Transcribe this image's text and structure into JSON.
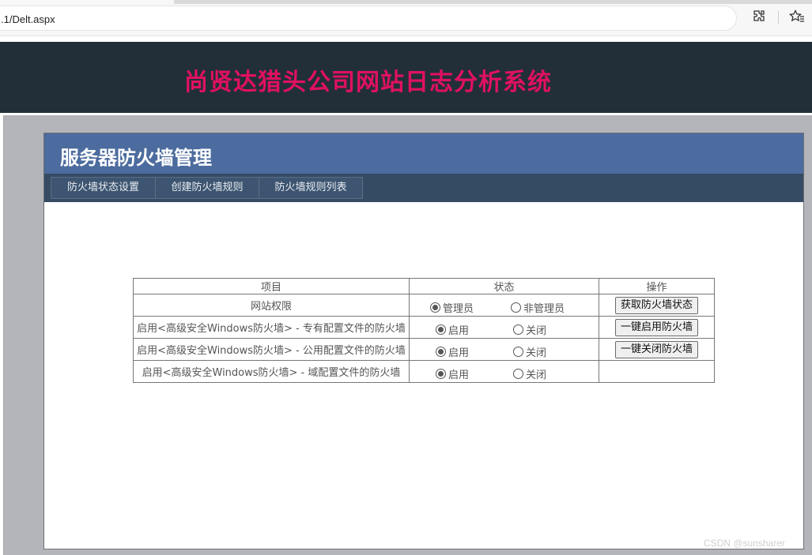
{
  "browser": {
    "url": ".1/Delt.aspx",
    "icons": [
      "extension-icon",
      "favorites-icon"
    ]
  },
  "site": {
    "title": "尚贤达猎头公司网站日志分析系统",
    "title_color": "#e0115f",
    "header_bg": "#222f39"
  },
  "panel": {
    "title": "服务器防火墙管理",
    "title_bg": "#4c6c9f",
    "nav_bg": "#354b63",
    "tabs": [
      {
        "label": "防火墙状态设置"
      },
      {
        "label": "创建防火墙规则"
      },
      {
        "label": "防火墙规则列表"
      }
    ]
  },
  "table": {
    "headers": {
      "item": "项目",
      "state": "状态",
      "op": "操作"
    },
    "rows": [
      {
        "item": "网站权限",
        "option_a": "管理员",
        "option_b": "非管理员",
        "selected": "option_a",
        "action": "获取防火墙状态"
      },
      {
        "item": "启用<高级安全Windows防火墙> - 专有配置文件的防火墙",
        "option_a": "启用",
        "option_b": "关闭",
        "selected": "option_a",
        "action": "一键启用防火墙"
      },
      {
        "item": "启用<高级安全Windows防火墙> - 公用配置文件的防火墙",
        "option_a": "启用",
        "option_b": "关闭",
        "selected": "option_a",
        "action": "一键关闭防火墙"
      },
      {
        "item": "启用<高级安全Windows防火墙> - 域配置文件的防火墙",
        "option_a": "启用",
        "option_b": "关闭",
        "selected": "option_a",
        "action": ""
      }
    ]
  },
  "watermark": "CSDN @sunsharer"
}
